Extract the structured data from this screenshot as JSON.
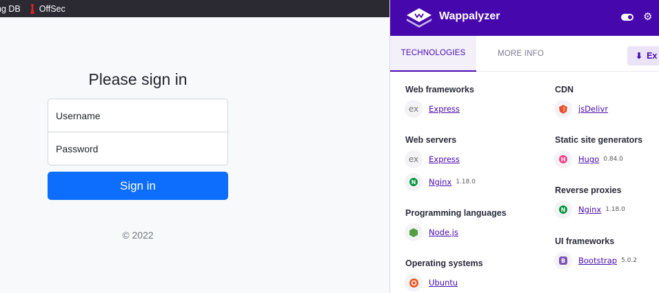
{
  "browser": {
    "bookmarks": [
      {
        "label": "king DB"
      },
      {
        "label": "OffSec"
      }
    ]
  },
  "login": {
    "heading": "Please sign in",
    "username_placeholder": "Username",
    "password_placeholder": "Password",
    "submit_label": "Sign in",
    "footer": "© 2022"
  },
  "wappalyzer": {
    "title": "Wappalyzer",
    "tabs": [
      {
        "label": "TECHNOLOGIES",
        "active": true
      },
      {
        "label": "MORE INFO",
        "active": false
      }
    ],
    "export_label": "Ex",
    "left_column": [
      {
        "category": "Web frameworks",
        "items": [
          {
            "name": "Express",
            "version": "",
            "icon": "express-icon",
            "glyph": "ex"
          }
        ]
      },
      {
        "category": "Web servers",
        "items": [
          {
            "name": "Express",
            "version": "",
            "icon": "express-icon",
            "glyph": "ex"
          },
          {
            "name": "Nginx",
            "version": "1.18.0",
            "icon": "nginx-icon",
            "glyph": "N",
            "color": "#009639"
          }
        ]
      },
      {
        "category": "Programming languages",
        "items": [
          {
            "name": "Node.js",
            "version": "",
            "icon": "nodejs-icon",
            "glyph": "",
            "color": "#539e43"
          }
        ]
      },
      {
        "category": "Operating systems",
        "items": [
          {
            "name": "Ubuntu",
            "version": "",
            "icon": "ubuntu-icon",
            "glyph": "",
            "color": "#e95420"
          }
        ]
      }
    ],
    "right_column": [
      {
        "category": "CDN",
        "items": [
          {
            "name": "jsDelivr",
            "version": "",
            "icon": "jsdelivr-icon",
            "glyph": "",
            "color": "#e84d3d"
          }
        ]
      },
      {
        "category": "Static site generators",
        "items": [
          {
            "name": "Hugo",
            "version": "0.84.0",
            "icon": "hugo-icon",
            "glyph": "H",
            "color": "#ff4088"
          }
        ]
      },
      {
        "category": "Reverse proxies",
        "items": [
          {
            "name": "Nginx",
            "version": "1.18.0",
            "icon": "nginx-icon",
            "glyph": "N",
            "color": "#009639"
          }
        ]
      },
      {
        "category": "UI frameworks",
        "items": [
          {
            "name": "Bootstrap",
            "version": "5.0.2",
            "icon": "bootstrap-icon",
            "glyph": "B",
            "color": "#7952b3"
          }
        ]
      }
    ]
  },
  "colors": {
    "wappalyzer_purple": "#4608ad",
    "signin_blue": "#0d6efd"
  }
}
